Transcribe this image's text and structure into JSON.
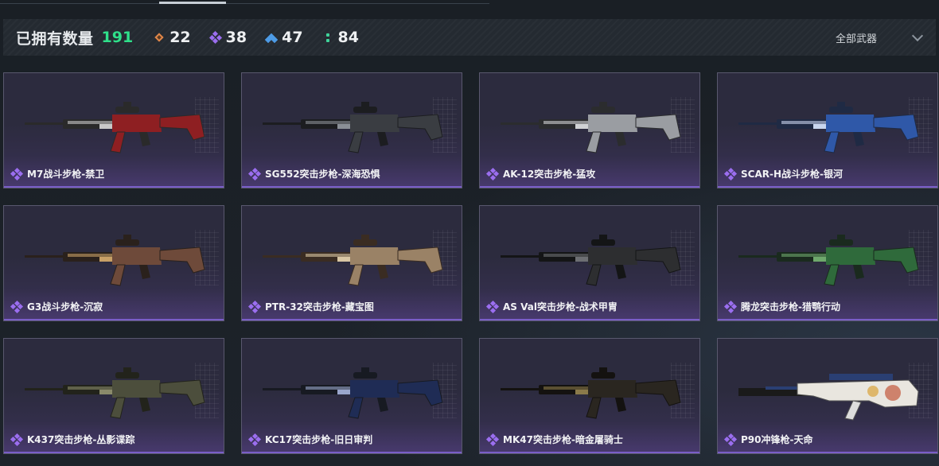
{
  "header": {
    "owned_label": "已拥有数量",
    "owned_count": "191",
    "stats": [
      {
        "icon": "orange-diamond-icon",
        "value": "22",
        "color": "#e0874a"
      },
      {
        "icon": "purple-quad-diamond-icon",
        "value": "38",
        "color": "#9b6ef0"
      },
      {
        "icon": "blue-chevron-icon",
        "value": "47",
        "color": "#4d9be6"
      },
      {
        "icon": "green-dots-icon",
        "value": "84",
        "color": "#3fd39a"
      }
    ],
    "filter_label": "全部武器"
  },
  "colors": {
    "accent_green": "#2fe08a",
    "rarity_purple": "#9b6ef0",
    "card_border": "#59586e"
  },
  "weapons": [
    {
      "name": "M7战斗步枪-禁卫",
      "rarity_icon": "purple-quad-diamond-icon",
      "skin": "red"
    },
    {
      "name": "SG552突击步枪-深海恐惧",
      "rarity_icon": "purple-quad-diamond-icon",
      "skin": "dark"
    },
    {
      "name": "AK-12突击步枪-猛攻",
      "rarity_icon": "purple-quad-diamond-icon",
      "skin": "silver"
    },
    {
      "name": "SCAR-H战斗步枪-银河",
      "rarity_icon": "purple-quad-diamond-icon",
      "skin": "blue"
    },
    {
      "name": "G3战斗步枪-沉寂",
      "rarity_icon": "purple-quad-diamond-icon",
      "skin": "copper"
    },
    {
      "name": "PTR-32突击步枪-藏宝图",
      "rarity_icon": "purple-quad-diamond-icon",
      "skin": "parchment"
    },
    {
      "name": "AS Val突击步枪-战术甲胄",
      "rarity_icon": "purple-quad-diamond-icon",
      "skin": "black"
    },
    {
      "name": "腾龙突击步枪-猎鹗行动",
      "rarity_icon": "purple-quad-diamond-icon",
      "skin": "green"
    },
    {
      "name": "K437突击步枪-丛影谍踪",
      "rarity_icon": "purple-quad-diamond-icon",
      "skin": "camo"
    },
    {
      "name": "KC17突击步枪-旧日审判",
      "rarity_icon": "purple-quad-diamond-icon",
      "skin": "navy"
    },
    {
      "name": "MK47突击步枪-暗金屠骑士",
      "rarity_icon": "purple-quad-diamond-icon",
      "skin": "darkgold"
    },
    {
      "name": "P90冲锋枪-天命",
      "rarity_icon": "purple-quad-diamond-icon",
      "skin": "white"
    }
  ]
}
